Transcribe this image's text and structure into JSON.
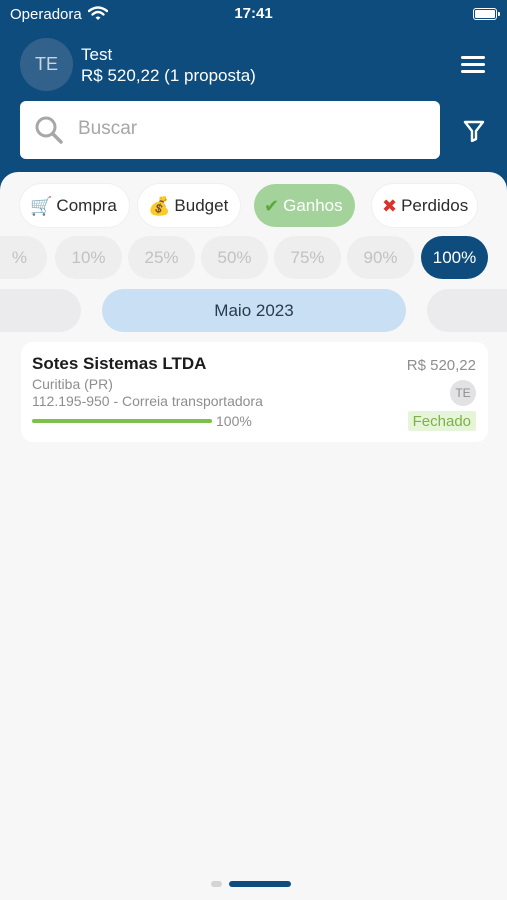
{
  "status_bar": {
    "carrier": "Operadora",
    "time": "17:41"
  },
  "user": {
    "initials": "TE",
    "name": "Test",
    "summary": "R$ 520,22 (1 proposta)"
  },
  "search": {
    "placeholder": "Buscar",
    "value": ""
  },
  "categories": [
    {
      "label": "Compra",
      "emoji": "🛒",
      "active": false
    },
    {
      "label": "Budget",
      "emoji": "💰",
      "active": false
    },
    {
      "label": "Ganhos",
      "emoji": "✔",
      "active": true
    },
    {
      "label": "Perdidos",
      "emoji": "✖",
      "active": false
    }
  ],
  "probabilities": [
    {
      "label": "%",
      "active": false
    },
    {
      "label": "10%",
      "active": false
    },
    {
      "label": "25%",
      "active": false
    },
    {
      "label": "50%",
      "active": false
    },
    {
      "label": "75%",
      "active": false
    },
    {
      "label": "90%",
      "active": false
    },
    {
      "label": "100%",
      "active": true
    }
  ],
  "period": {
    "label": "Maio 2023"
  },
  "deals": [
    {
      "company": "Sotes Sistemas LTDA",
      "city": "Curitiba (PR)",
      "address": "112.195-950 - Correia transportadora",
      "progress": 100,
      "progress_label": "100%",
      "amount": "R$ 520,22",
      "owner": "TE",
      "status": "Fechado"
    }
  ],
  "colors": {
    "brand": "#0d4c7d",
    "chip_active": "#a3d39a",
    "progress": "#7cc24a",
    "status_text": "#7cb342"
  }
}
